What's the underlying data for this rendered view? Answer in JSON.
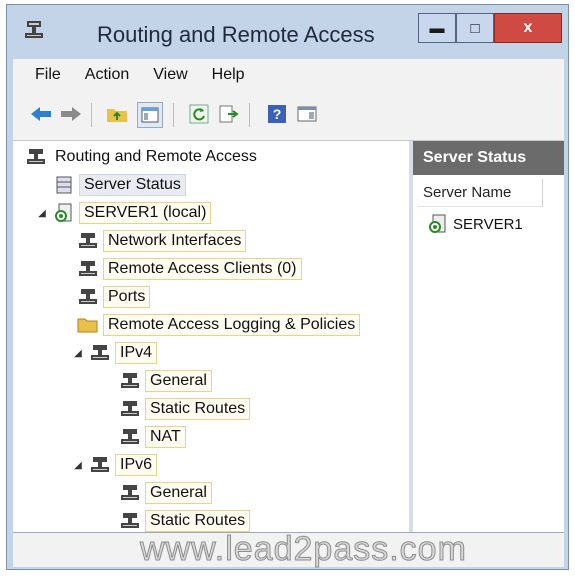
{
  "window": {
    "title": "Routing and Remote Access"
  },
  "menu": {
    "file": "File",
    "action": "Action",
    "view": "View",
    "help": "Help"
  },
  "tree": {
    "root": "Routing and Remote Access",
    "server_status": "Server Status",
    "server": "SERVER1 (local)",
    "network_interfaces": "Network Interfaces",
    "remote_access_clients": "Remote Access Clients (0)",
    "ports": "Ports",
    "logging_policies": "Remote Access Logging & Policies",
    "ipv4": "IPv4",
    "ipv4_general": "General",
    "ipv4_static_routes": "Static Routes",
    "ipv4_nat": "NAT",
    "ipv6": "IPv6",
    "ipv6_general": "General",
    "ipv6_static_routes": "Static Routes"
  },
  "right_pane": {
    "header": "Server Status",
    "column": "Server Name",
    "rows": [
      "SERVER1"
    ]
  },
  "watermark": "www.lead2pass.com",
  "colors": {
    "close_button": "#d04a44",
    "frame": "#c3d3e8",
    "pane_header": "#6b6b6b"
  }
}
